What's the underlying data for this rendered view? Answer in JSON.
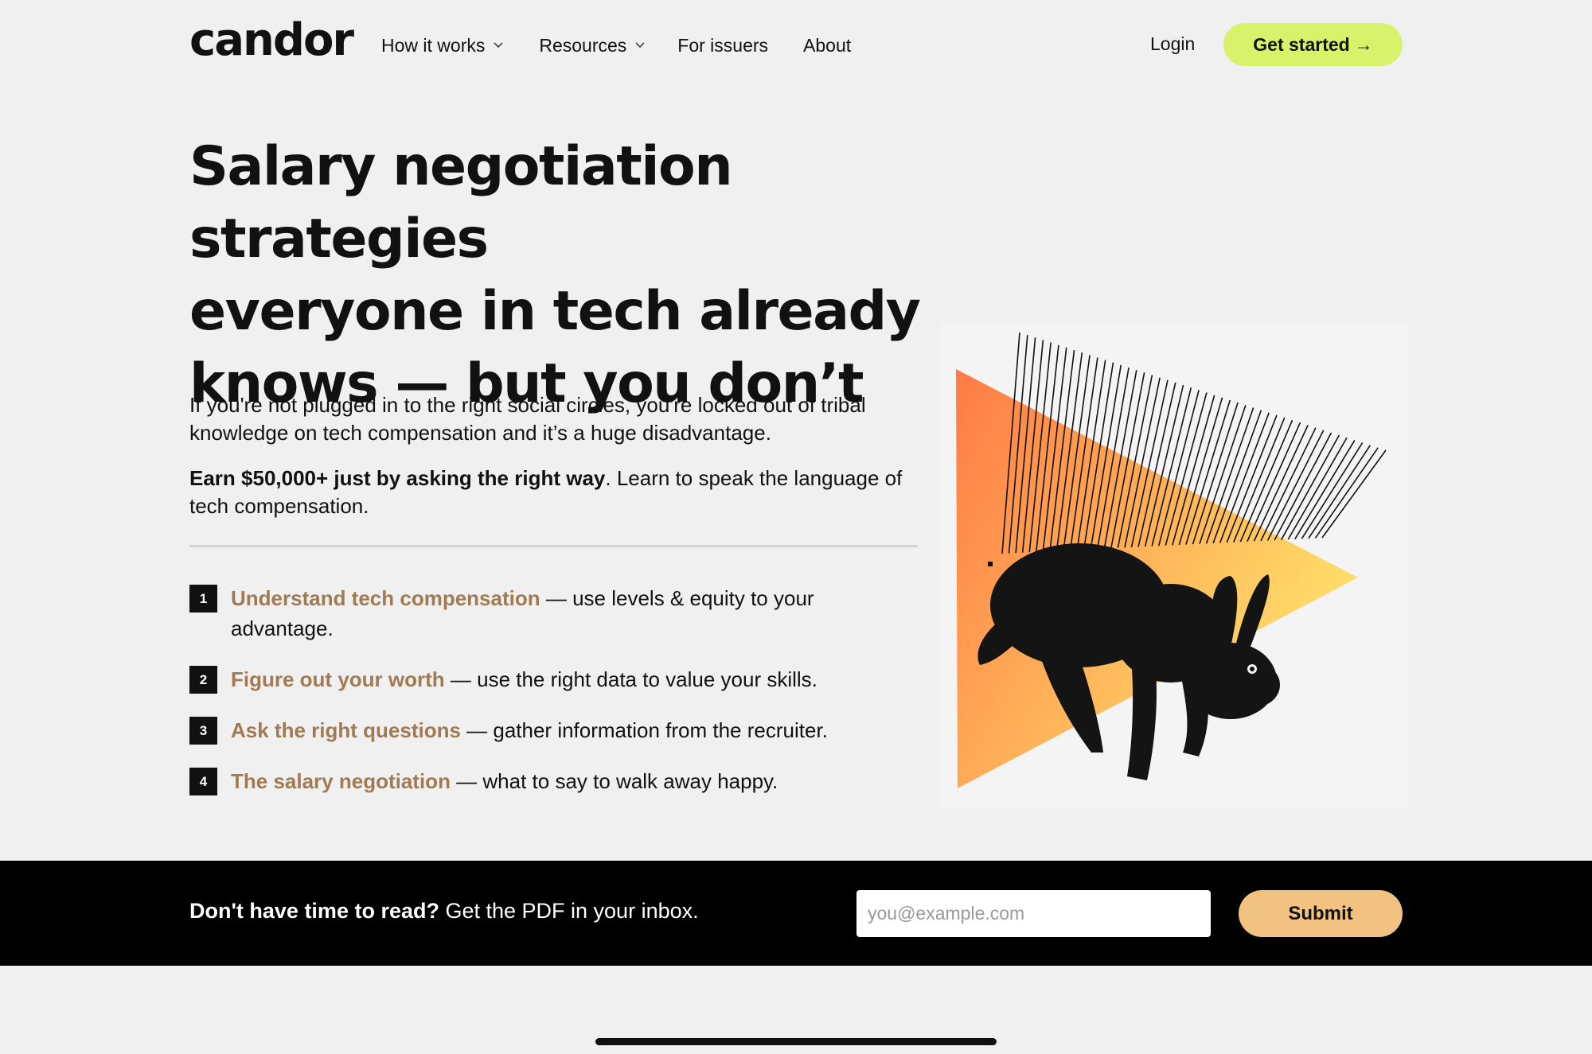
{
  "header": {
    "logo": "candor",
    "nav": [
      {
        "label": "How it works",
        "has_dropdown": true
      },
      {
        "label": "Resources",
        "has_dropdown": true
      },
      {
        "label": "For issuers",
        "has_dropdown": false
      },
      {
        "label": "About",
        "has_dropdown": false
      }
    ],
    "login_label": "Login",
    "cta_label": "Get started",
    "cta_arrow": "→",
    "cta_color": "#d9f26b"
  },
  "hero": {
    "headline_line1": "Salary negotiation strategies",
    "headline_line2": "everyone in tech already",
    "headline_line3": "knows — but you don’t",
    "intro": "If you're not plugged in to the right social circles, you're locked out of tribal knowledge on tech compensation and it’s a huge disadvantage.",
    "intro2_bold": "Earn $50,000+ just by asking the right way",
    "intro2_rest": ". Learn to speak the language of tech compensation."
  },
  "steps": [
    {
      "num": "1",
      "link": "Understand tech compensation",
      "rest": " — use levels & equity to your advantage."
    },
    {
      "num": "2",
      "link": "Figure out your worth",
      "rest": " — use the right data to value your skills."
    },
    {
      "num": "3",
      "link": "Ask the right questions",
      "rest": " — gather information from the recruiter."
    },
    {
      "num": "4",
      "link": "The salary negotiation",
      "rest": " — what to say to walk away happy."
    }
  ],
  "illustration": {
    "icon": "rabbit-triangle-illustration",
    "gradient_colors": [
      "#ff7a45",
      "#ffe36b"
    ]
  },
  "banner": {
    "bold": "Don't have time to read?",
    "rest": " Get the PDF in your inbox.",
    "email_placeholder": "you@example.com",
    "submit_label": "Submit",
    "submit_color": "#f2c283"
  },
  "colors": {
    "background": "#f0f0f0",
    "link": "#a07a52",
    "banner_bg": "#000000"
  }
}
